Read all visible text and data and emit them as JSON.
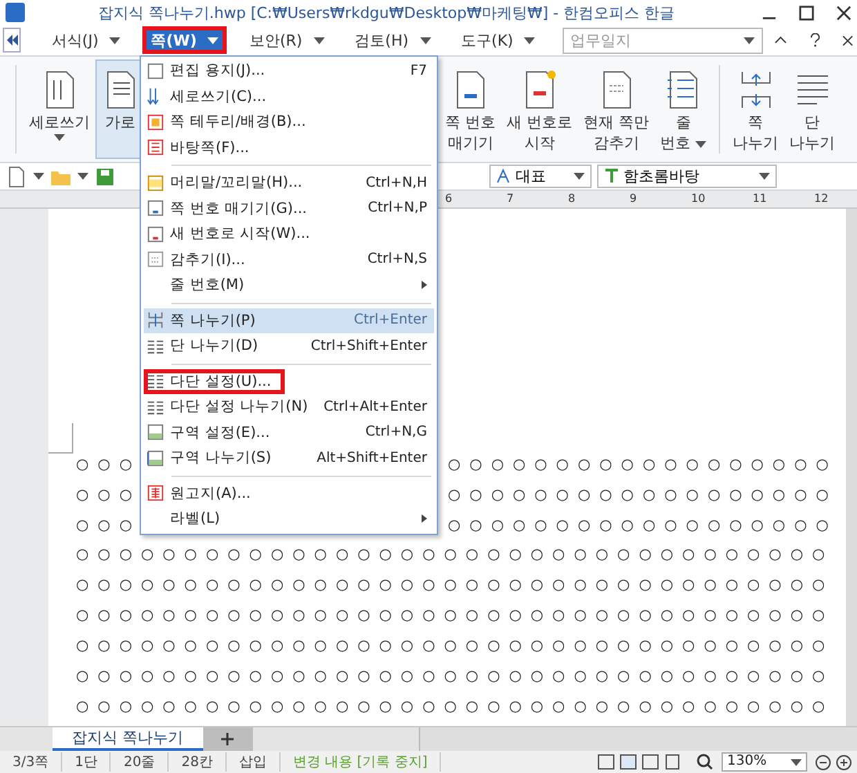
{
  "window": {
    "title": "잡지식 쪽나누기.hwp [C:₩Users₩rkdgu₩Desktop₩마케팅₩] - 한컴오피스 한글"
  },
  "menu_bar": {
    "items": [
      {
        "label": "서식(J)",
        "selected": false,
        "highlighted": false
      },
      {
        "label": "쪽(W)",
        "selected": true,
        "highlighted": true
      },
      {
        "label": "보안(R)",
        "selected": false,
        "highlighted": false
      },
      {
        "label": "검토(H)",
        "selected": false,
        "highlighted": false
      },
      {
        "label": "도구(K)",
        "selected": false,
        "highlighted": false
      }
    ],
    "style_box": {
      "placeholder": "업무일지"
    }
  },
  "ribbon": {
    "left_items": [
      {
        "kind": "vertical",
        "lines": [
          "세로쓰기"
        ],
        "dropdown": true,
        "selected": false
      },
      {
        "kind": "horizontal",
        "lines": [
          "가로"
        ],
        "dropdown": false,
        "selected": true
      }
    ],
    "right_items": [
      {
        "kind": "page-number",
        "lines": [
          "쪽 번호",
          "매기기"
        ],
        "dropdown": false,
        "selected": false
      },
      {
        "kind": "new-number",
        "lines": [
          "새 번호로",
          "시작"
        ],
        "dropdown": false,
        "selected": false
      },
      {
        "kind": "hide",
        "lines": [
          "현재 쪽만",
          "감추기"
        ],
        "dropdown": false,
        "selected": false
      },
      {
        "kind": "line-number",
        "lines": [
          "줄",
          "번호"
        ],
        "dropdown": true,
        "selected": false
      },
      {
        "kind": "page-break",
        "lines": [
          "쪽",
          "나누기"
        ],
        "dropdown": false,
        "selected": false
      },
      {
        "kind": "column-break",
        "lines": [
          "단",
          "나누기"
        ],
        "dropdown": false,
        "selected": false
      }
    ]
  },
  "toolbar": {
    "style": "대표",
    "font": "함초롬바탕"
  },
  "ruler": {
    "numbers": [
      "6",
      "7",
      "8",
      "9",
      "10",
      "11",
      "12"
    ]
  },
  "dropdown_menu": {
    "items": [
      {
        "kind": "item",
        "label": "편집 용지(J)...",
        "shortcut": "F7",
        "selected": false,
        "submenu": false,
        "highlighted": false
      },
      {
        "kind": "item",
        "label": "세로쓰기(C)...",
        "selected": false,
        "submenu": false,
        "highlighted": false
      },
      {
        "kind": "item",
        "label": "쪽 테두리/배경(B)...",
        "selected": false,
        "submenu": false,
        "highlighted": false
      },
      {
        "kind": "item",
        "label": "바탕쪽(F)...",
        "selected": false,
        "submenu": false,
        "highlighted": false
      },
      {
        "kind": "separator"
      },
      {
        "kind": "item",
        "label": "머리말/꼬리말(H)...",
        "shortcut": "Ctrl+N,H",
        "selected": false,
        "submenu": false,
        "highlighted": false
      },
      {
        "kind": "item",
        "label": "쪽 번호 매기기(G)...",
        "shortcut": "Ctrl+N,P",
        "selected": false,
        "submenu": false,
        "highlighted": false
      },
      {
        "kind": "item",
        "label": "새 번호로 시작(W)...",
        "selected": false,
        "submenu": false,
        "highlighted": false
      },
      {
        "kind": "item",
        "label": "감추기(I)...",
        "shortcut": "Ctrl+N,S",
        "selected": false,
        "submenu": false,
        "highlighted": false
      },
      {
        "kind": "item",
        "label": "줄 번호(M)",
        "selected": false,
        "submenu": true,
        "highlighted": false
      },
      {
        "kind": "separator"
      },
      {
        "kind": "item",
        "label": "쪽 나누기(P)",
        "shortcut": "Ctrl+Enter",
        "selected": true,
        "submenu": false,
        "highlighted": false
      },
      {
        "kind": "item",
        "label": "단 나누기(D)",
        "shortcut": "Ctrl+Shift+Enter",
        "selected": false,
        "submenu": false,
        "highlighted": false
      },
      {
        "kind": "separator"
      },
      {
        "kind": "item",
        "label": "다단 설정(U)...",
        "selected": false,
        "submenu": false,
        "highlighted": true
      },
      {
        "kind": "item",
        "label": "다단 설정 나누기(N)",
        "shortcut": "Ctrl+Alt+Enter",
        "selected": false,
        "submenu": false,
        "highlighted": false
      },
      {
        "kind": "item",
        "label": "구역 설정(E)...",
        "shortcut": "Ctrl+N,G",
        "selected": false,
        "submenu": false,
        "highlighted": false
      },
      {
        "kind": "item",
        "label": "구역 나누기(S)",
        "shortcut": "Alt+Shift+Enter",
        "selected": false,
        "submenu": false,
        "highlighted": false
      },
      {
        "kind": "separator"
      },
      {
        "kind": "item",
        "label": "원고지(A)...",
        "selected": false,
        "submenu": false,
        "highlighted": false
      },
      {
        "kind": "item",
        "label": "라벨(L)",
        "selected": false,
        "submenu": true,
        "highlighted": false
      }
    ]
  },
  "document": {
    "rows": [
      {
        "segments": [
          "○○○",
          "○○○○○○○○○○○○○○○○○○"
        ]
      },
      {
        "segments": [
          "○○○",
          "○○○○○○○○○○○○○○○○○○"
        ]
      },
      {
        "segments": [
          "○○○",
          "○○○○○○○○○○○○○○○○○○"
        ]
      },
      {
        "segments": [
          "○○○○○○○○○○○○○○○○○○○○○○○○○○○○○○○○○○○"
        ]
      },
      {
        "segments": [
          "○○○○○○○○○○○○○○○○○○○○○○○○○○○○○○○○○○○"
        ]
      },
      {
        "segments": [
          "○○○○○○○○○○○○○○○○○○○○○○○○○○○○○○○○○○○"
        ]
      },
      {
        "segments": [
          "○○○○○○○○○○○○○○○○○○○○○○○○○○○○○○○○○○○"
        ]
      },
      {
        "segments": [
          "○○○○○○○○○○○○○○○○○○○○○○○○○○○○○○○○○○○"
        ]
      },
      {
        "segments": [
          "○○○○○○○○○○○○○○○○○○○○○○○○○○○○○○○○○○○"
        ]
      }
    ]
  },
  "sheet_tabs": [
    {
      "label": "잡지식 쪽나누기",
      "selected": true
    }
  ],
  "status_bar": {
    "items": [
      {
        "kind": "plain",
        "text": "3/3쪽"
      },
      {
        "kind": "plain",
        "text": "1단"
      },
      {
        "kind": "plain",
        "text": "20줄"
      },
      {
        "kind": "plain",
        "text": "28칸"
      },
      {
        "kind": "plain",
        "text": "삽입"
      },
      {
        "kind": "track",
        "text": "변경 내용 [기록 중지]"
      }
    ],
    "zoom": "130%"
  }
}
